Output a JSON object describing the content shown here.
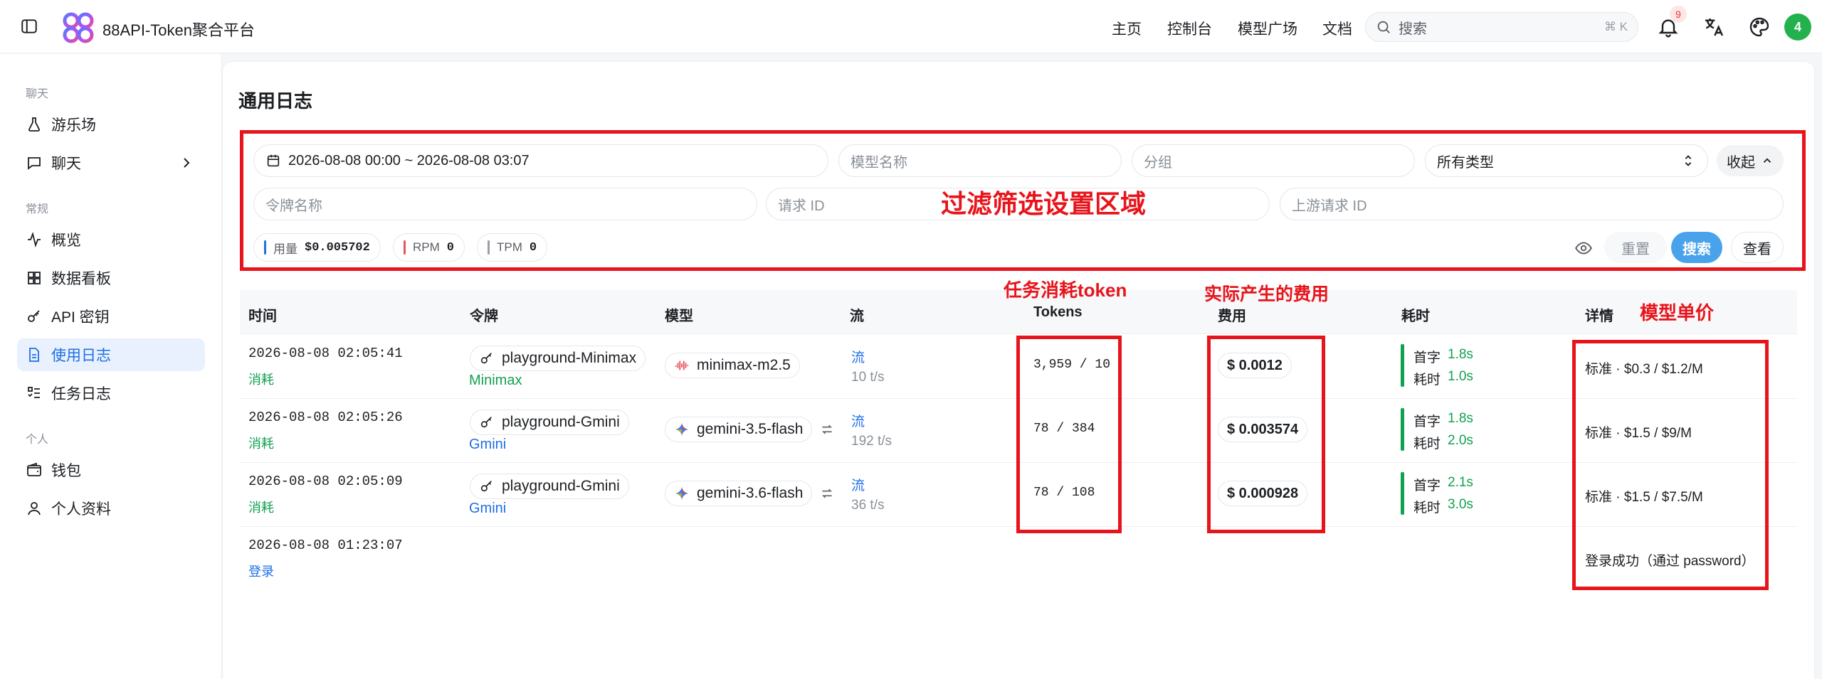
{
  "app": {
    "brand": "88API-Token聚合平台"
  },
  "nav": {
    "home": "主页",
    "console": "控制台",
    "models": "模型广场",
    "docs": "文档"
  },
  "search": {
    "placeholder": "搜索",
    "shortcut": "⌘ K"
  },
  "notifications": {
    "count": "9"
  },
  "user": {
    "avatar_label": "4"
  },
  "sidebar": {
    "sections": {
      "chat": "聊天",
      "general": "常规",
      "personal": "个人"
    },
    "items": {
      "playground": "游乐场",
      "chat": "聊天",
      "overview": "概览",
      "dashboard": "数据看板",
      "api_keys": "API 密钥",
      "usage_logs": "使用日志",
      "task_logs": "任务日志",
      "wallet": "钱包",
      "profile": "个人资料"
    }
  },
  "page": {
    "title": "通用日志"
  },
  "filters": {
    "date_range": "2026-08-08 00:00 ~ 2026-08-08 03:07",
    "model_placeholder": "模型名称",
    "group_placeholder": "分组",
    "type_value": "所有类型",
    "collapse_label": "收起",
    "token_placeholder": "令牌名称",
    "request_id_placeholder": "请求 ID",
    "upstream_id_placeholder": "上游请求 ID",
    "reset_label": "重置",
    "search_label": "搜索",
    "view_label": "查看"
  },
  "stats": {
    "usage_label": "用量",
    "usage_value": "$0.005702",
    "rpm_label": "RPM",
    "rpm_value": "0",
    "tpm_label": "TPM",
    "tpm_value": "0"
  },
  "annotations": {
    "filter_area": "过滤筛选设置区域",
    "tokens": "任务消耗token",
    "cost": "实际产生的费用",
    "unit_price": "模型单价"
  },
  "table": {
    "headers": [
      "时间",
      "令牌",
      "模型",
      "流",
      "Tokens",
      "费用",
      "耗时",
      "详情"
    ],
    "rows": [
      {
        "time": "2026-08-08 02:05:41",
        "type": "消耗",
        "token": "playground-Minimax",
        "group": "Minimax",
        "model": "minimax-m2.5",
        "stream": "流",
        "speed": "10 t/s",
        "tokens": "3,959 / 10",
        "cost": "$ 0.0012",
        "first_label": "首字",
        "first_value": "1.8s",
        "total_label": "耗时",
        "total_value": "1.0s",
        "detail": "标准 · $0.3 / $1.2/M"
      },
      {
        "time": "2026-08-08 02:05:26",
        "type": "消耗",
        "token": "playground-Gmini",
        "group": "Gmini",
        "model": "gemini-3.5-flash",
        "stream": "流",
        "speed": "192 t/s",
        "tokens": "78 / 384",
        "cost": "$ 0.003574",
        "first_label": "首字",
        "first_value": "1.8s",
        "total_label": "耗时",
        "total_value": "2.0s",
        "detail": "标准 · $1.5 / $9/M"
      },
      {
        "time": "2026-08-08 02:05:09",
        "type": "消耗",
        "token": "playground-Gmini",
        "group": "Gmini",
        "model": "gemini-3.6-flash",
        "stream": "流",
        "speed": "36 t/s",
        "tokens": "78 / 108",
        "cost": "$ 0.000928",
        "first_label": "首字",
        "first_value": "2.1s",
        "total_label": "耗时",
        "total_value": "3.0s",
        "detail": "标准 · $1.5 / $7.5/M"
      },
      {
        "time": "2026-08-08 01:23:07",
        "type": "登录",
        "detail": "登录成功（通过 password）"
      }
    ]
  },
  "colors": {
    "accent": "#1f6fe5",
    "success": "#12a150",
    "annotation": "#e8141b",
    "search_button": "#4aa3ea"
  }
}
